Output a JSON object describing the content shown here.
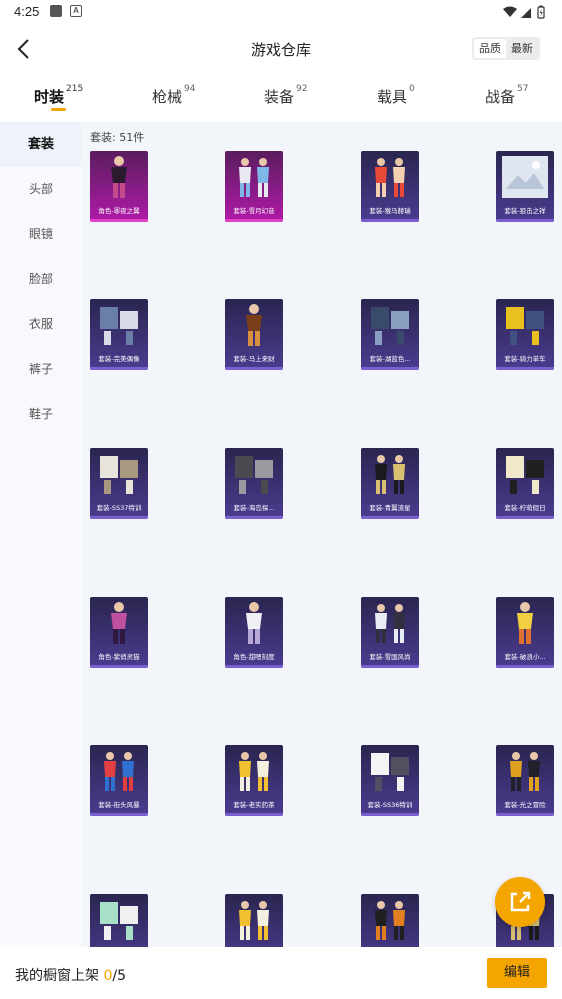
{
  "status": {
    "time": "4:25"
  },
  "header": {
    "title": "游戏仓库",
    "sort_options": [
      "品质",
      "最新"
    ],
    "sort_active": 0
  },
  "tabs": [
    {
      "label": "时装",
      "count": "215",
      "active": true
    },
    {
      "label": "枪械",
      "count": "94",
      "active": false
    },
    {
      "label": "装备",
      "count": "92",
      "active": false
    },
    {
      "label": "载具",
      "count": "0",
      "active": false
    },
    {
      "label": "战备",
      "count": "57",
      "active": false
    }
  ],
  "sidebar": {
    "items": [
      {
        "label": "套装",
        "active": true
      },
      {
        "label": "头部",
        "active": false
      },
      {
        "label": "眼镜",
        "active": false
      },
      {
        "label": "脸部",
        "active": false
      },
      {
        "label": "衣服",
        "active": false
      },
      {
        "label": "裤子",
        "active": false
      },
      {
        "label": "鞋子",
        "active": false
      }
    ]
  },
  "main": {
    "count_label": "套装: 51件",
    "items": [
      {
        "caption": "角色-罪夜之翼",
        "tier": "legendary",
        "art": "figure-dark"
      },
      {
        "caption": "套装-雪月幻音",
        "tier": "legendary",
        "art": "figure-pair-light"
      },
      {
        "caption": "套装-猴马赫瑞",
        "tier": "epic",
        "art": "figure-pair-red"
      },
      {
        "caption": "套装-狙击之祥",
        "tier": "epic",
        "art": "placeholder-image"
      },
      {
        "caption": "套装-完美偶像",
        "tier": "epic",
        "art": "outfit-blue"
      },
      {
        "caption": "套装-马上来财",
        "tier": "epic",
        "art": "figure-brown"
      },
      {
        "caption": "套装-湖蓝色...",
        "tier": "epic",
        "art": "outfit-navy"
      },
      {
        "caption": "套装-骑力单车",
        "tier": "epic",
        "art": "outfit-yellow"
      },
      {
        "caption": "套装-SS37特训",
        "tier": "epic",
        "art": "outfit-white"
      },
      {
        "caption": "套装-海岛探...",
        "tier": "epic",
        "art": "outfit-grey-coat"
      },
      {
        "caption": "套装-青翼流星",
        "tier": "epic",
        "art": "figure-pair-black"
      },
      {
        "caption": "套装-柠萌假日",
        "tier": "epic",
        "art": "outfit-cream"
      },
      {
        "caption": "角色-紫俏灵猫",
        "tier": "epic",
        "art": "figure-pink"
      },
      {
        "caption": "角色-甜嗯刻度",
        "tier": "epic",
        "art": "figure-white"
      },
      {
        "caption": "套装-雪国风尚",
        "tier": "epic",
        "art": "figure-pair-white"
      },
      {
        "caption": "套装-破浪小...",
        "tier": "epic",
        "art": "figure-yellow"
      },
      {
        "caption": "套装-街头风暴",
        "tier": "epic",
        "art": "figure-pair-color"
      },
      {
        "caption": "套装-老实药茶",
        "tier": "epic",
        "art": "figure-pair-yellow"
      },
      {
        "caption": "套装-SS36特训",
        "tier": "epic",
        "art": "outfit-white2"
      },
      {
        "caption": "套装-光之冒险",
        "tier": "epic",
        "art": "figure-pair-gold"
      },
      {
        "caption": "",
        "tier": "epic",
        "art": "outfit-mint"
      },
      {
        "caption": "",
        "tier": "epic",
        "art": "figure-pair-yellow"
      },
      {
        "caption": "",
        "tier": "epic",
        "art": "figure-pair-dark"
      },
      {
        "caption": "",
        "tier": "epic",
        "art": "figure-pair-black"
      }
    ]
  },
  "bottom": {
    "shelf_label": "我的橱窗上架 ",
    "shelf_count": "0",
    "shelf_sep": "/",
    "shelf_total": "5",
    "edit_label": "编辑"
  },
  "colors": {
    "accent": "#f5a500",
    "legendary_top": "#5a1d5f",
    "legendary_bottom": "#b01aa8",
    "legendary_bar": "#e040c8",
    "epic_top": "#2a2550",
    "epic_bottom": "#4b3c90",
    "epic_bar": "#7a5fd0"
  },
  "icons": [
    "back-arrow-icon",
    "share-external-icon",
    "wifi-icon",
    "signal-icon",
    "battery-icon"
  ]
}
